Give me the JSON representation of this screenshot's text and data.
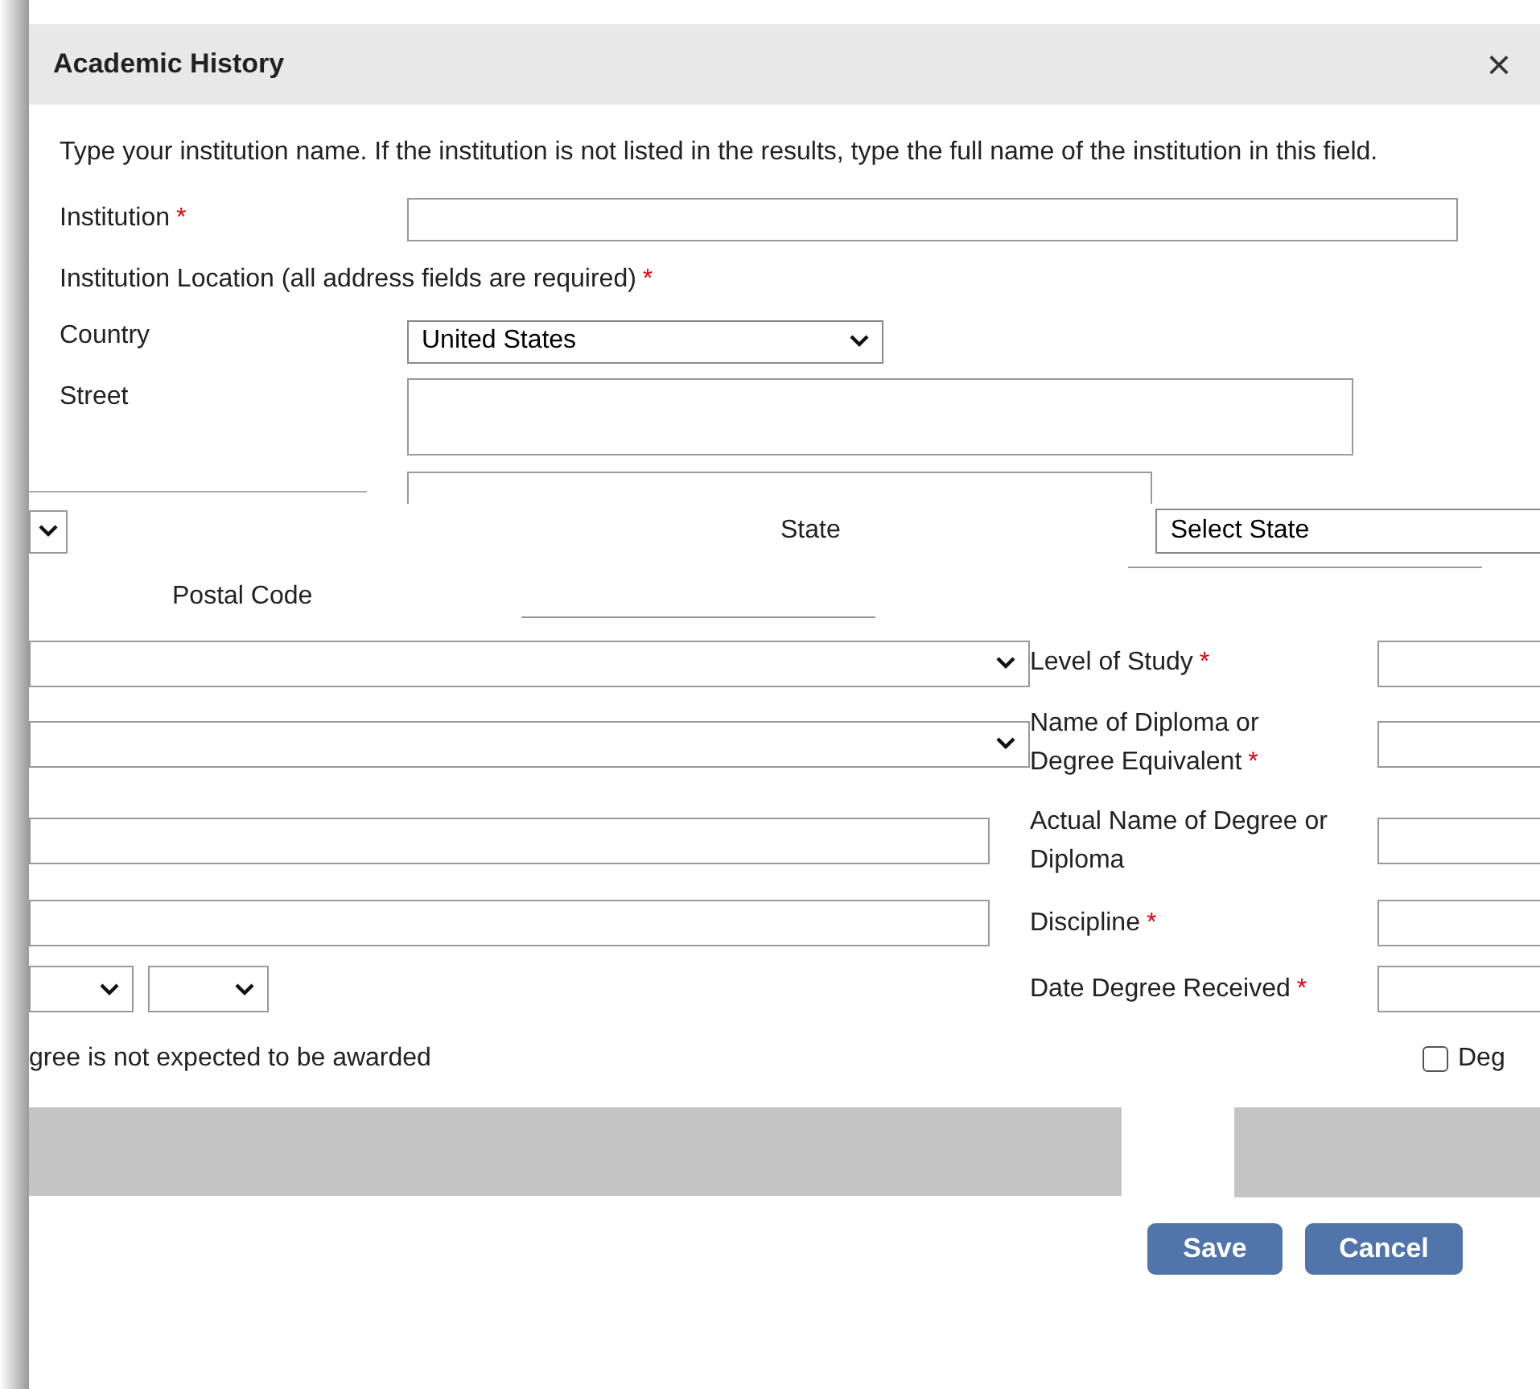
{
  "dialog": {
    "title": "Academic History",
    "close": "×"
  },
  "instructions": "Type your institution name. If the institution is not listed in the results, type the full name of the institution in this field.",
  "top_fields": [
    {
      "kind": "input",
      "label": "Institution",
      "marker": "*"
    },
    {
      "kind": "heading",
      "label": "Institution Location (all address fields are required)",
      "marker": "*"
    },
    {
      "kind": "select",
      "label": "Country",
      "value": "United States"
    },
    {
      "kind": "textarea",
      "label": "Street"
    }
  ],
  "state": {
    "label": "State",
    "value": "Select State"
  },
  "postal": {
    "label": "Postal Code"
  },
  "left_controls": [
    {
      "kind": "select"
    },
    {
      "kind": "select"
    },
    {
      "kind": "input"
    },
    {
      "kind": "input"
    },
    {
      "kind": "select-pair"
    }
  ],
  "right_fields": [
    {
      "label": "Level of Study",
      "marker": "*"
    },
    {
      "label": "Name of Diploma or Degree Equivalent",
      "marker": "*"
    },
    {
      "label": "Actual Name of Degree or Diploma"
    },
    {
      "label": "Discipline",
      "marker": "*"
    },
    {
      "label": "Date Degree Received",
      "marker": "*"
    }
  ],
  "note": "gree is not expected to be awarded",
  "checkbox": {
    "label": "Deg",
    "checked": false
  },
  "buttons": [
    "Save",
    "Cancel"
  ]
}
